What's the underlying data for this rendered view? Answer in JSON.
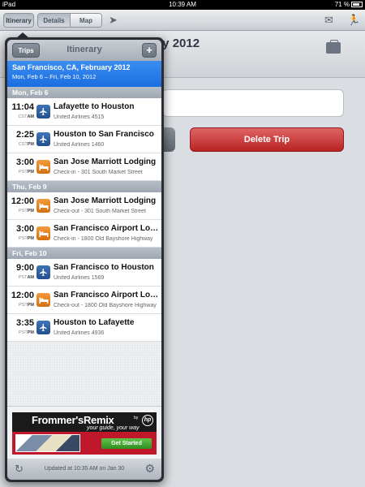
{
  "status_bar": {
    "device": "iPad",
    "time": "10:39 AM",
    "battery": "71 %"
  },
  "toolbar": {
    "itinerary_label": "Itinerary",
    "details_label": "Details",
    "map_label": "Map"
  },
  "detail": {
    "title_fragment": "ary 2012",
    "delete_label": "Delete Trip"
  },
  "popover": {
    "title": "Itinerary",
    "trips_label": "Trips",
    "add_label": "+",
    "trip_title": "San Francisco, CA, February 2012",
    "trip_dates": "Mon, Feb 6 – Fri, Feb 10, 2012",
    "sections": [
      {
        "header": "Mon, Feb 6",
        "rows": [
          {
            "time": "11:04",
            "tz": "CST",
            "ampm": "AM",
            "type": "flight",
            "title": "Lafayette to Houston",
            "subtitle": "United Airlines 4515"
          },
          {
            "time": "2:25",
            "tz": "CST",
            "ampm": "PM",
            "type": "flight",
            "title": "Houston to San Francisco",
            "subtitle": "United Airlines 1460"
          },
          {
            "time": "3:00",
            "tz": "PST",
            "ampm": "PM",
            "type": "hotel",
            "title": "San Jose Marriott Lodging",
            "subtitle": "Check-in - 301 South Market Street"
          }
        ]
      },
      {
        "header": "Thu, Feb 9",
        "rows": [
          {
            "time": "12:00",
            "tz": "PST",
            "ampm": "PM",
            "type": "hotel",
            "title": "San Jose Marriott Lodging",
            "subtitle": "Check-out - 301 South Market Street"
          },
          {
            "time": "3:00",
            "tz": "PST",
            "ampm": "PM",
            "type": "hotel",
            "title": "San Francisco Airport Lodging",
            "subtitle": "Check-in - 1800 Old Bayshore Highway"
          }
        ]
      },
      {
        "header": "Fri, Feb 10",
        "rows": [
          {
            "time": "9:00",
            "tz": "PST",
            "ampm": "AM",
            "type": "flight",
            "title": "San Francisco to Houston",
            "subtitle": "United Airlines 1569"
          },
          {
            "time": "12:00",
            "tz": "PST",
            "ampm": "PM",
            "type": "hotel",
            "title": "San Francisco Airport Lodging",
            "subtitle": "Check-out - 1800 Old Bayshore Highway"
          },
          {
            "time": "3:35",
            "tz": "PST",
            "ampm": "PM",
            "type": "flight",
            "title": "Houston to Lafayette",
            "subtitle": "United Airlines 4936"
          }
        ]
      }
    ],
    "ad": {
      "brand": "Frommer'sRemix",
      "by": "by",
      "hp": "hp",
      "tagline": "your guide, your way",
      "cta": "Get Started"
    },
    "updated": "Updated at 10:35 AM on Jan 30"
  },
  "icons": {
    "flight": "airplane-icon",
    "hotel": "bed-icon"
  }
}
